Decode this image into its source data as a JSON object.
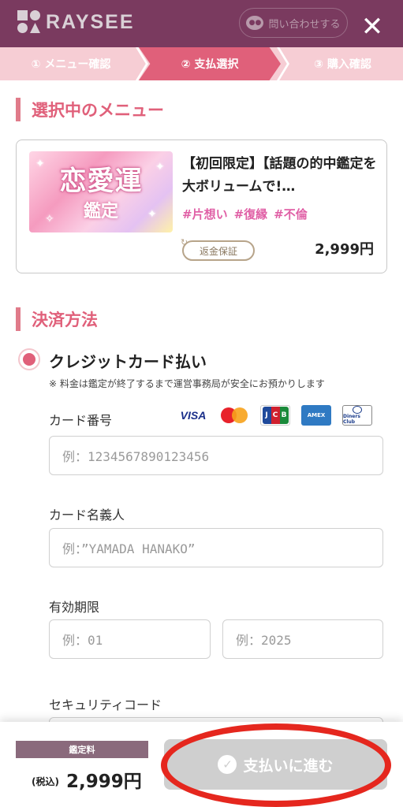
{
  "header": {
    "logo_text": "RAYSEE",
    "contact_label": "問い合わせする",
    "contact_icon": "chat-bubble-icon",
    "close_icon": "close-icon",
    "brand_color": "#7a3a5f"
  },
  "steps": [
    {
      "label": "① メニュー確認",
      "state": "done"
    },
    {
      "label": "② 支払選択",
      "state": "active"
    },
    {
      "label": "③ 購入確認",
      "state": "upcoming"
    }
  ],
  "menu_section": {
    "title": "選択中のメニュー",
    "item": {
      "thumb_main": "恋愛運",
      "thumb_sub": "鑑定",
      "title": "【初回限定】【話題の的中鑑定を大ボリュームで!…",
      "tags": [
        "#片想い",
        "#復縁",
        "#不倫"
      ],
      "refund_label": "返金保証",
      "price": "2,999円"
    }
  },
  "payment_section": {
    "title": "決済方法",
    "method_label": "クレジットカード払い",
    "note": "※ 料金は鑑定が終了するまで運営事務局が安全にお預かりします",
    "brands": {
      "visa": "VISA",
      "jcb": "JCB",
      "amex": "AMEX",
      "diners": "Diners Club"
    },
    "fields": {
      "card_number_label": "カード番号",
      "card_number_placeholder": "例：1234567890123456",
      "holder_label": "カード名義人",
      "holder_placeholder": "例：”YAMADA HANAKO”",
      "expiry_label": "有効期限",
      "expiry_month_placeholder": "例：01",
      "expiry_year_placeholder": "例：2025",
      "security_label": "セキュリティコード"
    }
  },
  "footer": {
    "fee_label": "鑑定料",
    "tax_label": "(税込)",
    "price": "2,999円",
    "pay_button_label": "支払いに進む",
    "pay_icon": "check-circle-icon"
  },
  "colors": {
    "accent": "#e0607a",
    "step_bg": "#f6cdd4",
    "highlight_ring": "#e5271e"
  }
}
